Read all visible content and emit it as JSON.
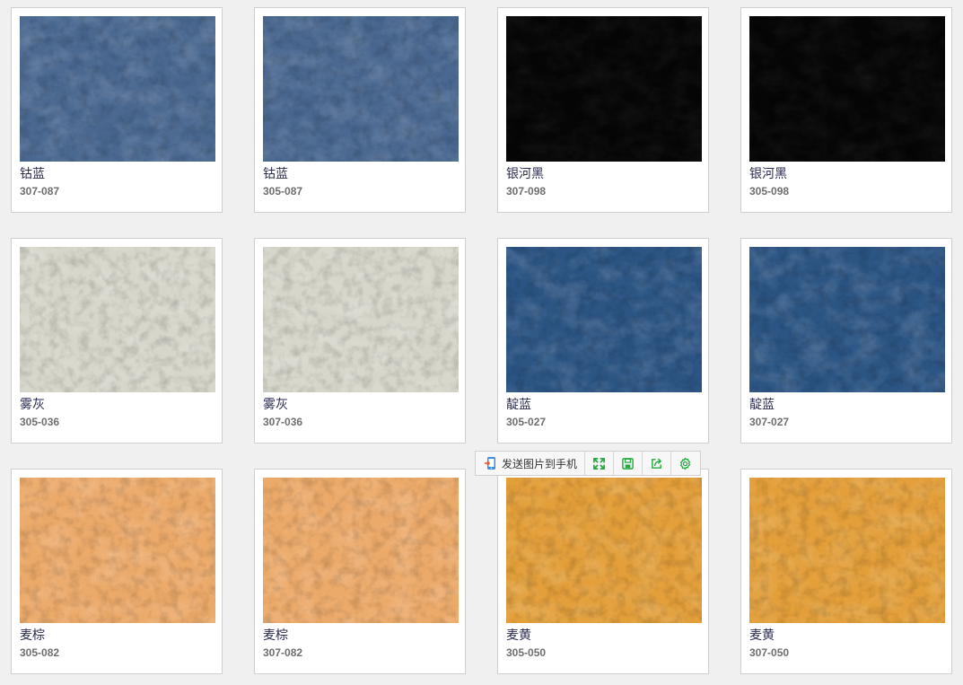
{
  "swatches": [
    {
      "name": "钴蓝",
      "code": "307-087",
      "color": "#4a6890"
    },
    {
      "name": "钴蓝",
      "code": "305-087",
      "color": "#4a6890"
    },
    {
      "name": "银河黑",
      "code": "307-098",
      "color": "#060606"
    },
    {
      "name": "银河黑",
      "code": "305-098",
      "color": "#060606"
    },
    {
      "name": "雾灰",
      "code": "305-036",
      "color": "#d7d6cb"
    },
    {
      "name": "雾灰",
      "code": "307-036",
      "color": "#d7d6cb"
    },
    {
      "name": "靛蓝",
      "code": "305-027",
      "color": "#2c5584"
    },
    {
      "name": "靛蓝",
      "code": "307-027",
      "color": "#2c5584"
    },
    {
      "name": "麦棕",
      "code": "305-082",
      "color": "#ecaa6a"
    },
    {
      "name": "麦棕",
      "code": "307-082",
      "color": "#ecaa6a"
    },
    {
      "name": "麦黄",
      "code": "305-050",
      "color": "#e39f3a"
    },
    {
      "name": "麦黄",
      "code": "307-050",
      "color": "#e39f3a"
    }
  ],
  "toolbar": {
    "send_label": "发送图片到手机",
    "accent": "#22a83c",
    "buttons": [
      "fullscreen-icon",
      "save-icon",
      "share-icon",
      "settings-icon"
    ]
  }
}
